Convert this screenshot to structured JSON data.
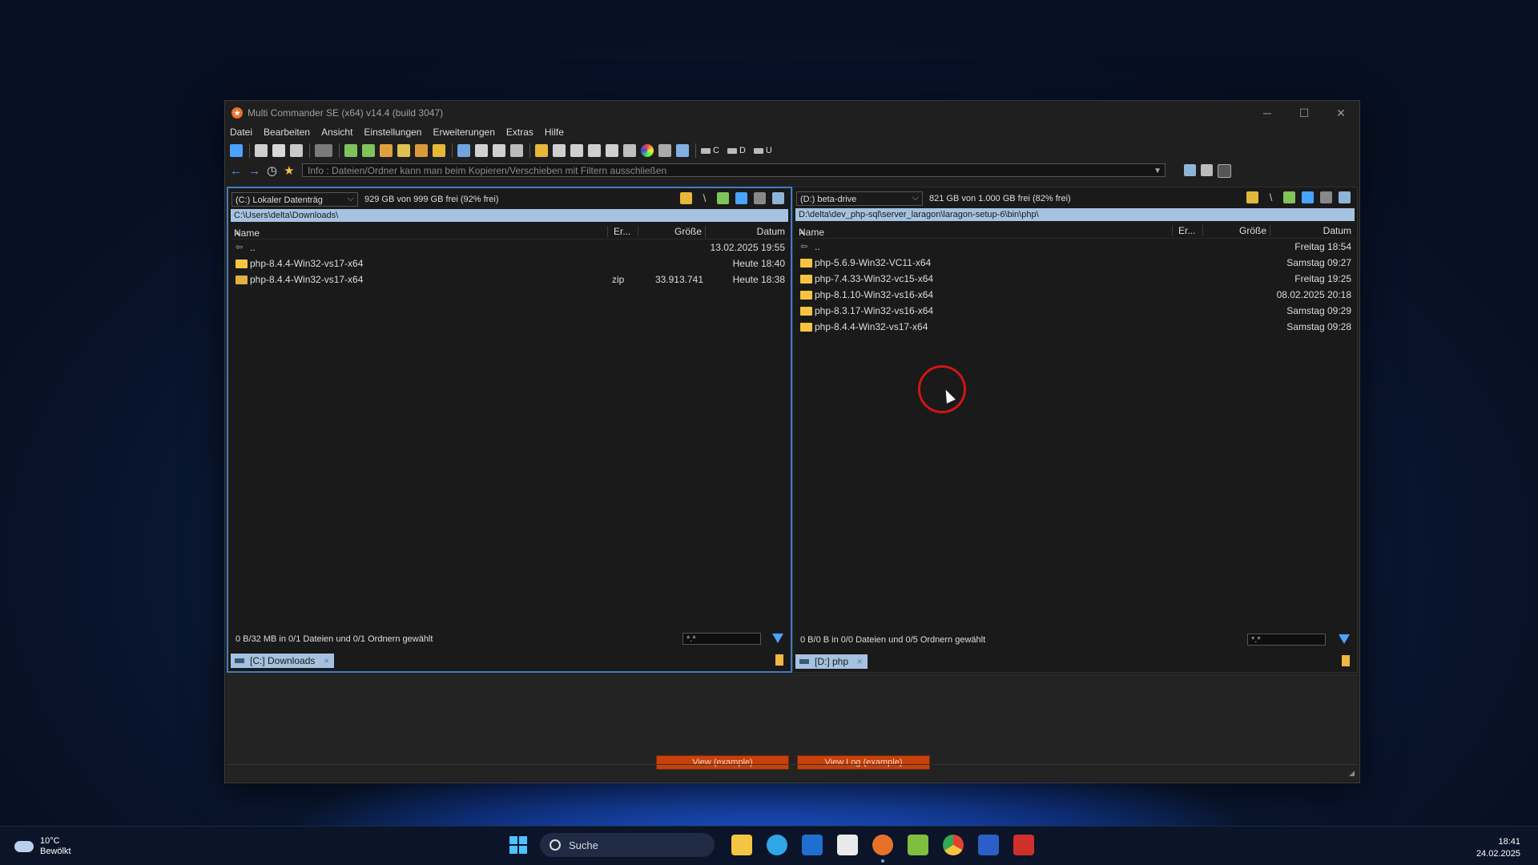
{
  "window": {
    "title": "Multi Commander SE (x64)  v14.4 (build 3047)",
    "controls": [
      "─",
      "☐",
      "✕"
    ]
  },
  "menu": [
    "Datei",
    "Bearbeiten",
    "Ansicht",
    "Einstellungen",
    "Erweiterungen",
    "Extras",
    "Hilfe"
  ],
  "toolbar": {
    "drives": [
      "C",
      "D",
      "U"
    ]
  },
  "commandline": {
    "placeholder": "Info : Dateien/Ordner kann man beim Kopieren/Verschieben mit Filtern ausschließen"
  },
  "columns": {
    "name": "Name",
    "ext": "Er...",
    "size": "Größe",
    "date": "Datum"
  },
  "left": {
    "drive": "(C:) Lokaler Datenträg",
    "free": "929 GB von 999 GB frei (92% frei)",
    "path": "C:\\Users\\delta\\Downloads\\",
    "rows": [
      {
        "name": "..",
        "ext": "",
        "size": "",
        "date": "13.02.2025 19:55"
      },
      {
        "name": "php-8.4.4-Win32-vs17-x64",
        "ext": "",
        "size": "",
        "date": "Heute 18:40"
      },
      {
        "name": "php-8.4.4-Win32-vs17-x64",
        "ext": "zip",
        "size": "33.913.741",
        "date": "Heute 18:38"
      }
    ],
    "status": "0 B/32 MB in 0/1 Dateien und 0/1 Ordnern gewählt",
    "filter": "*.*",
    "tab": "[C:] Downloads"
  },
  "right": {
    "drive": "(D:) beta-drive",
    "free": "821 GB von 1.000 GB frei (82% frei)",
    "path": "D:\\delta\\dev_php-sql\\server_laragon\\laragon-setup-6\\bin\\php\\",
    "rows": [
      {
        "name": "..",
        "date": "Freitag 18:54"
      },
      {
        "name": "php-5.6.9-Win32-VC11-x64",
        "date": "Samstag 09:27"
      },
      {
        "name": "php-7.4.33-Win32-vc15-x64",
        "date": "Freitag 19:25"
      },
      {
        "name": "php-8.1.10-Win32-vs16-x64",
        "date": "08.02.2025 20:18"
      },
      {
        "name": "php-8.3.17-Win32-vs16-x64",
        "date": "Samstag 09:29"
      },
      {
        "name": "php-8.4.4-Win32-vs17-x64",
        "date": "Samstag 09:28"
      }
    ],
    "status": "0 B/0 B in 0/0 Dateien und 0/5 Ordnern gewählt",
    "filter": "*.*",
    "tab": "[D:] php"
  },
  "log": {
    "view_button": "View (example)",
    "viewlog_button": "View Log (example)"
  },
  "taskbar": {
    "temperature": "10°C",
    "weather": "Bewölkt",
    "search": "Suche",
    "time": "18:41",
    "date": "24.02.2025",
    "colors": {
      "explorer": "#f4c542",
      "edge": "#2fa7e6",
      "outlook": "#1f6fd1",
      "store": "#e9e9e9",
      "multicommander": "#e8712a",
      "notepad": "#7fbf3f",
      "chrome": "#e44133",
      "word": "#2b5fc7",
      "app": "#d0302b"
    }
  }
}
